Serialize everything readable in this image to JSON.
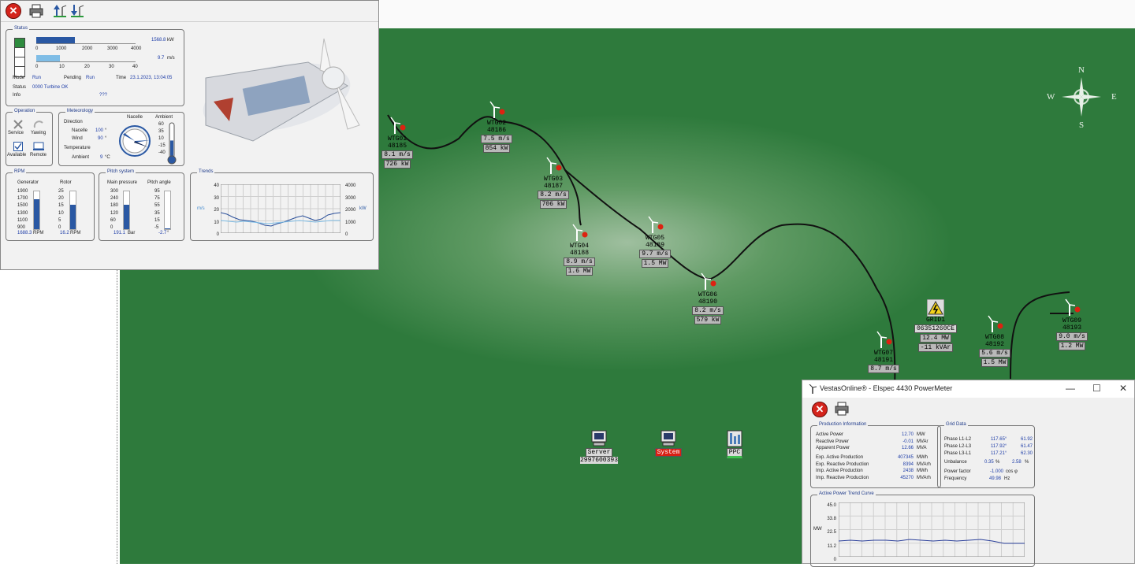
{
  "map": {
    "compass": {
      "n": "N",
      "s": "S",
      "e": "E",
      "w": "W"
    },
    "turbines": [
      {
        "name": "WTG01",
        "id": "48185",
        "wind": "8.1 m/s",
        "power": "726 kW"
      },
      {
        "name": "WTG02",
        "id": "48186",
        "wind": "7.5 m/s",
        "power": "854 kW"
      },
      {
        "name": "WTG03",
        "id": "48187",
        "wind": "8.2 m/s",
        "power": "706 kW"
      },
      {
        "name": "WTG04",
        "id": "48188",
        "wind": "8.9 m/s",
        "power": "1.6 MW"
      },
      {
        "name": "WTG05",
        "id": "48189",
        "wind": "9.7 m/s",
        "power": "1.5 MW"
      },
      {
        "name": "WTG06",
        "id": "48190",
        "wind": "8.2 m/s",
        "power": "579 kW"
      },
      {
        "name": "WTG07",
        "id": "48191",
        "wind": "8.7 m/s",
        "power": ""
      },
      {
        "name": "WTG08",
        "id": "48192",
        "wind": "5.6 m/s",
        "power": "1.5 MW"
      },
      {
        "name": "WTG09",
        "id": "48193",
        "wind": "9.0 m/s",
        "power": "1.2 MW"
      }
    ],
    "grid": {
      "name": "GRID1",
      "id": "06351260CE",
      "power": "12.4 MW",
      "reactive": "-11 kVAr"
    },
    "server": {
      "name": "Server",
      "id": "2997600393"
    },
    "system": {
      "name": "System"
    },
    "ppc": {
      "name": "PPC"
    }
  },
  "turbine_window": {
    "status": {
      "title": "Status",
      "power_value": "1568.8",
      "power_unit": "kW",
      "power_ticks": [
        "0",
        "1000",
        "2000",
        "3000",
        "4000"
      ],
      "wind_value": "9.7",
      "wind_unit": "m/s",
      "wind_ticks": [
        "0",
        "10",
        "20",
        "30",
        "40"
      ],
      "power_fraction": 0.39,
      "wind_fraction": 0.24,
      "mode_label": "Mode",
      "mode_value": "Run",
      "pending_label": "Pending",
      "pending_value": "Run",
      "time_label": "Time",
      "time_value": "23.1.2023, 13:04:05",
      "status_label": "Status",
      "status_value": "0000 Turbine OK",
      "info_label": "Info",
      "info_value": "???"
    },
    "operation": {
      "title": "Operation",
      "service": "Service",
      "yawing": "Yawing",
      "available": "Available",
      "remote": "Remote"
    },
    "meteorology": {
      "title": "Meteorology",
      "direction": "Direction",
      "nacelle_label": "Nacelle",
      "nacelle_value": "100",
      "nacelle_unit": "°",
      "wind_label": "Wind",
      "wind_value": "90",
      "wind_unit": "°",
      "temperature": "Temperature",
      "ambient_label": "Ambient",
      "ambient_value": "9",
      "ambient_unit": "°C",
      "gauge_title": "Nacelle",
      "thermo_title": "Ambient",
      "thermo_ticks": [
        "60",
        "35",
        "10",
        "-15",
        "-40"
      ],
      "temp_value": 9
    },
    "rpm": {
      "title": "RPM",
      "generator_label": "Generator",
      "rotor_label": "Rotor",
      "gen_ticks": [
        "1900",
        "1700",
        "1500",
        "1300",
        "1100",
        "900"
      ],
      "rotor_ticks": [
        "25",
        "20",
        "15",
        "10",
        "5",
        "0"
      ],
      "gen_value": "1688.3",
      "rotor_value": "16.2",
      "unit": "RPM",
      "gen_fraction": 0.79,
      "rotor_fraction": 0.65
    },
    "pitch": {
      "title": "Pitch system",
      "pressure_label": "Main pressure",
      "angle_label": "Pitch angle",
      "pressure_ticks": [
        "300",
        "240",
        "180",
        "120",
        "60",
        "0"
      ],
      "angle_ticks": [
        "95",
        "75",
        "55",
        "35",
        "15",
        "-5"
      ],
      "pressure_value": "191.1",
      "pressure_unit": "Bar",
      "angle_value": "-2.7",
      "angle_unit": "°",
      "pressure_fraction": 0.64,
      "angle_fraction": 0.03
    },
    "trends": {
      "title": "Trends",
      "left_ticks": [
        "40",
        "30",
        "20",
        "10",
        "0"
      ],
      "right_ticks": [
        "4000",
        "3000",
        "2000",
        "1000",
        "0"
      ],
      "left_unit": "m/s",
      "right_unit": "kW"
    }
  },
  "power_meter": {
    "title": "VestasOnline® - Elspec 4430 PowerMeter",
    "production": {
      "title": "Production Information",
      "rows": [
        {
          "label": "Active Power",
          "value": "12.70",
          "unit": "MW"
        },
        {
          "label": "Reactive Power",
          "value": "-0.01",
          "unit": "MVAr"
        },
        {
          "label": "Apparent Power",
          "value": "12.66",
          "unit": "MVA"
        },
        {
          "label": "Exp. Active Production",
          "value": "407345",
          "unit": "MWh"
        },
        {
          "label": "Exp. Reactive Production",
          "value": "8394",
          "unit": "MVArh"
        },
        {
          "label": "Imp. Active Production",
          "value": "2438",
          "unit": "MWh"
        },
        {
          "label": "Imp. Reactive Production",
          "value": "45270",
          "unit": "MVArh"
        }
      ]
    },
    "grid": {
      "title": "Grid Data",
      "phases": [
        {
          "label": "Phase L1-L2",
          "angle": "117.65°",
          "value": "61.92"
        },
        {
          "label": "Phase L2-L3",
          "angle": "117.92°",
          "value": "61.47"
        },
        {
          "label": "Phase L3-L1",
          "angle": "117.21°",
          "value": "62.30"
        }
      ],
      "unbalance_label": "Unbalance",
      "unbalance_1": "0.35",
      "unbalance_unit1": "%",
      "unbalance_2": "2.58",
      "unbalance_unit2": "%",
      "pf_label": "Power factor",
      "pf_value": "-1.000",
      "pf_unit": "cos φ",
      "freq_label": "Frequency",
      "freq_value": "49.98",
      "freq_unit": "Hz"
    },
    "trend": {
      "title": "Active Power Trend Curve",
      "ticks": [
        "45.0",
        "33.8",
        "22.5",
        "11.2",
        "0"
      ],
      "unit": "MW"
    }
  }
}
